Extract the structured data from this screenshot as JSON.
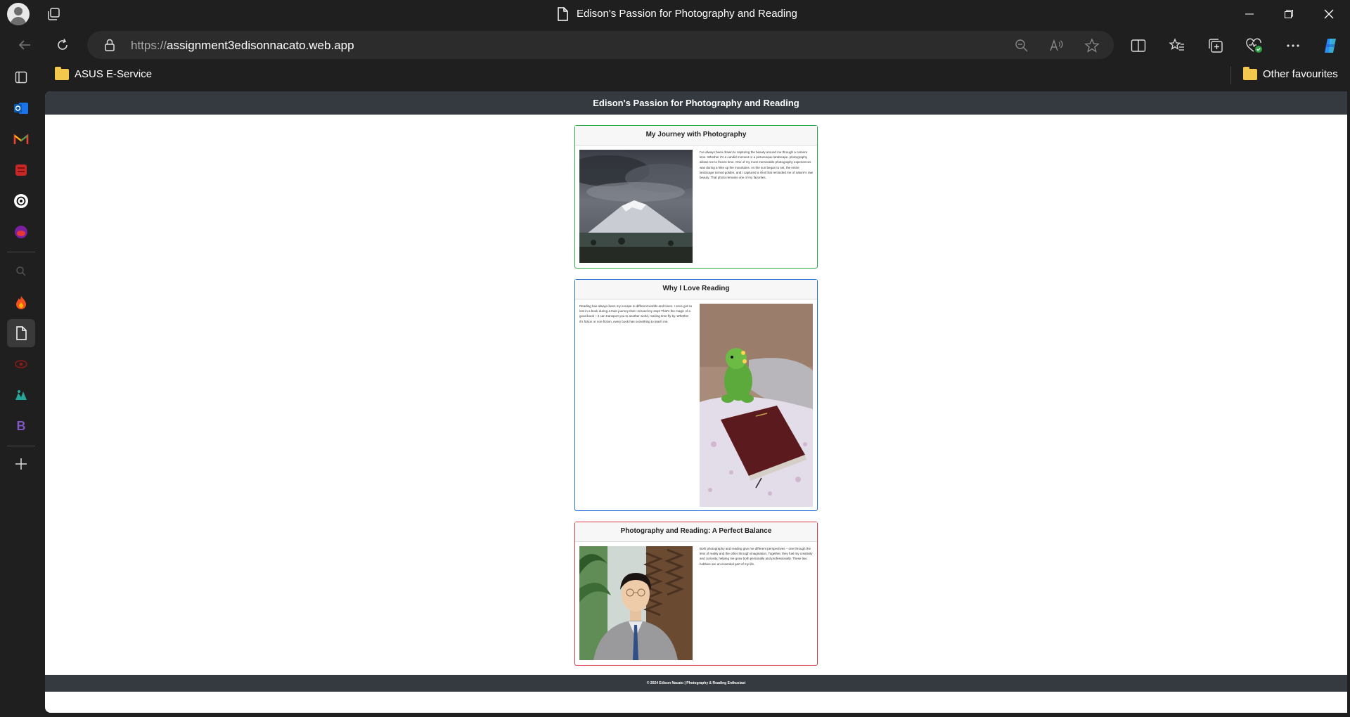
{
  "browser": {
    "window_title": "Edison's Passion for Photography and Reading",
    "url_protocol": "https://",
    "url_host": "assignment3edisonnacato.web.app",
    "favorites": [
      {
        "label": "ASUS E-Service",
        "icon": "folder-icon"
      },
      {
        "label": "Other favourites",
        "icon": "folder-icon"
      }
    ],
    "sidebar_apps": [
      "tab-actions-icon",
      "outlook-icon",
      "gmail-icon",
      "red-app-icon",
      "chatgpt-icon",
      "purple-app-icon",
      "search-icon",
      "flame-app-icon",
      "page-icon",
      "red-eye-app-icon",
      "green-app-icon",
      "b-app-icon",
      "add-icon"
    ],
    "sidebar_b_letter": "B"
  },
  "page": {
    "header_title": "Edison's Passion for Photography and Reading",
    "footer_text": "© 2024 Edison Nacato | Photography & Reading Enthusiast",
    "cards": [
      {
        "title": "My Journey with Photography",
        "text": "I've always been drawn to capturing the beauty around me through a camera lens. Whether it's a candid moment or a picturesque landscape, photography allows me to freeze time. One of my most memorable photography experiences was during a hike up the mountains. As the sun began to set, the entire landscape turned golden, and I captured a shot that reminded me of nature's raw beauty. That photo remains one of my favorites.",
        "image": "mountain-photo",
        "border_color": "#28a745"
      },
      {
        "title": "Why I Love Reading",
        "text": "Reading has always been my escape to different worlds and times. I once got so lost in a book during a train journey that I missed my stop! That's the magic of a good book – it can transport you to another world, making time fly by. Whether it's fiction or non-fiction, every book has something to teach me.",
        "image": "dinosaur-book-photo",
        "border_color": "#1e6fd9"
      },
      {
        "title": "Photography and Reading: A Perfect Balance",
        "text": "Both photography and reading give me different perspectives – one through the lens of reality and the other through imagination. Together, they fuel my creativity and curiosity, helping me grow both personally and professionally. These two hobbies are an essential part of my life.",
        "image": "portrait-photo",
        "border_color": "#dc3545"
      }
    ]
  }
}
